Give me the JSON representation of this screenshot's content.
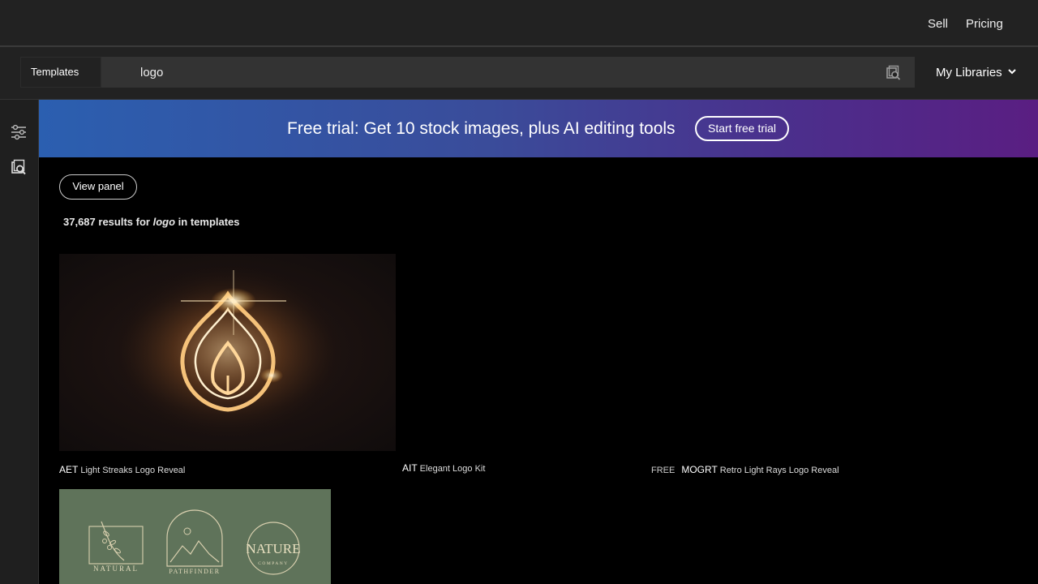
{
  "header": {
    "nav": [
      {
        "label": "Sell"
      },
      {
        "label": "Pricing"
      }
    ]
  },
  "search": {
    "scope_label": "Templates",
    "query": "logo",
    "libraries_label": "My Libraries"
  },
  "banner": {
    "text": "Free trial: Get 10 stock images, plus AI editing tools",
    "button_label": "Start free trial"
  },
  "results": {
    "view_panel_label": "View panel",
    "count": "37,687",
    "prefix": "results for",
    "term": "logo",
    "suffix": "in templates"
  },
  "items": [
    {
      "format": "AET",
      "title": "Light Streaks Logo Reveal"
    },
    {
      "format": "AIT",
      "title": "Elegant Logo Kit"
    },
    {
      "badge": "FREE",
      "format": "MOGRT",
      "title": "Retro Light Rays Logo Reveal"
    }
  ],
  "thumb_texts": {
    "natural": "NATURAL",
    "pathfinder": "PATHFINDER",
    "nature": "NATURE",
    "company": "COMPANY"
  },
  "colors": {
    "banner_start": "#2b5fb0",
    "banner_end": "#5a1e82",
    "topbar": "#222222",
    "sidebar": "#1f1f1f"
  },
  "icons": {
    "visual_search": "image-search-icon",
    "filters": "sliders-icon",
    "sidebar_visual_search": "image-search-icon",
    "libraries_caret": "chevron-down-icon"
  }
}
